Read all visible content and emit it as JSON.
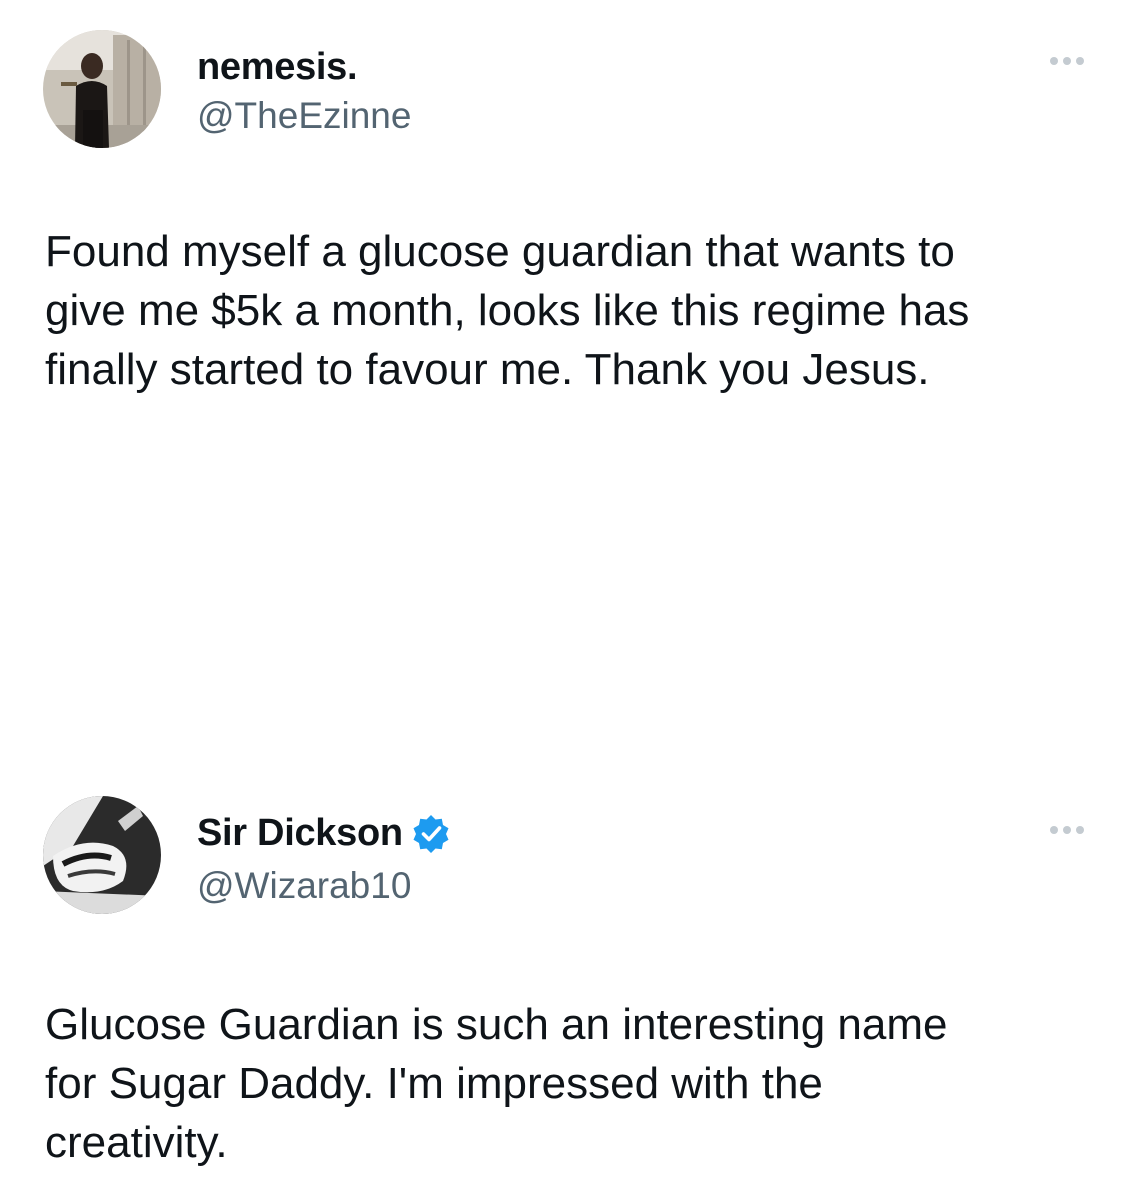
{
  "tweets": [
    {
      "display_name": "nemesis.",
      "handle": "@TheEzinne",
      "verified": false,
      "avatar_icon": "user-photo-avatar",
      "more_icon": "ellipsis-icon",
      "text": "Found myself a glucose guardian that wants to\ngive me $5k a month, looks like this regime has\nfinally started to favour me. Thank you Jesus."
    },
    {
      "display_name": "Sir Dickson",
      "handle": "@Wizarab10",
      "verified": true,
      "verified_color": "#1d9bf0",
      "avatar_icon": "user-photo-avatar",
      "more_icon": "ellipsis-icon",
      "text": "Glucose Guardian is such an interesting name\nfor Sugar Daddy. I'm impressed with the\ncreativity."
    }
  ],
  "colors": {
    "text": "#0f1419",
    "secondary_text": "#536471",
    "verified_blue": "#1d9bf0"
  }
}
